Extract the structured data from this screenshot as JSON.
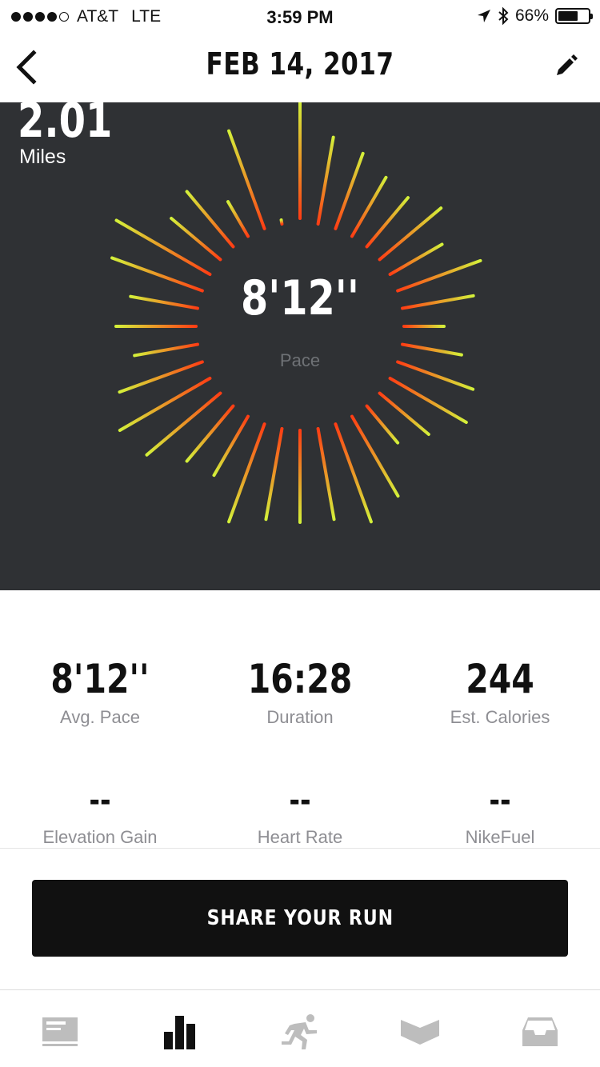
{
  "status_bar": {
    "carrier": "AT&T",
    "network": "LTE",
    "time": "3:59 PM",
    "battery_percent": "66%",
    "battery_level": 0.66,
    "signal_bars": 4,
    "signal_max": 5
  },
  "nav": {
    "title": "FEB 14, 2017",
    "back_icon": "chevron-left-icon",
    "edit_icon": "pencil-icon"
  },
  "hero": {
    "distance": "2.01",
    "distance_unit": "Miles",
    "pace_value": "8'12''",
    "pace_label": "Pace",
    "colors": {
      "background": "#2f3134",
      "fast": "#d4f03a",
      "slow": "#ff3d14"
    }
  },
  "stats": [
    {
      "value": "8'12''",
      "label": "Avg. Pace"
    },
    {
      "value": "16:28",
      "label": "Duration"
    },
    {
      "value": "244",
      "label": "Est. Calories"
    },
    {
      "value": "--",
      "label": "Elevation Gain"
    },
    {
      "value": "--",
      "label": "Heart Rate"
    },
    {
      "value": "--",
      "label": "NikeFuel"
    }
  ],
  "share_button": {
    "label": "SHARE YOUR RUN"
  },
  "tabbar": [
    {
      "name": "feed",
      "icon": "newspaper-icon",
      "active": false
    },
    {
      "name": "activity",
      "icon": "bar-chart-icon",
      "active": true
    },
    {
      "name": "run",
      "icon": "runner-icon",
      "active": false
    },
    {
      "name": "coach",
      "icon": "chevron-banner-icon",
      "active": false
    },
    {
      "name": "inbox",
      "icon": "inbox-tray-icon",
      "active": false
    }
  ]
}
